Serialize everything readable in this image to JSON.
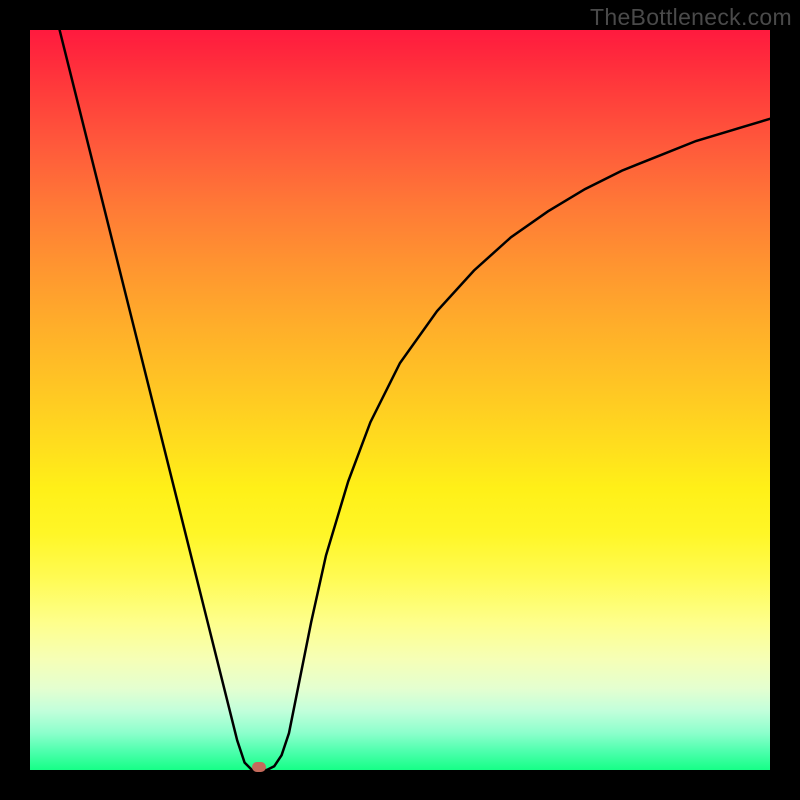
{
  "watermark": "TheBottleneck.com",
  "marker": {
    "color": "#c46a5b"
  },
  "chart_data": {
    "type": "line",
    "title": "",
    "xlabel": "",
    "ylabel": "",
    "xlim": [
      0,
      100
    ],
    "ylim": [
      0,
      100
    ],
    "grid": false,
    "x": [
      4,
      6,
      8,
      10,
      12,
      14,
      16,
      18,
      20,
      22,
      24,
      26,
      28,
      29,
      30,
      31,
      32,
      33,
      34,
      35,
      36,
      38,
      40,
      43,
      46,
      50,
      55,
      60,
      65,
      70,
      75,
      80,
      85,
      90,
      95,
      100
    ],
    "values": [
      100,
      92,
      84,
      76,
      68,
      60,
      52,
      44,
      36,
      28,
      20,
      12,
      4,
      1,
      0,
      0,
      0,
      0.5,
      2,
      5,
      10,
      20,
      29,
      39,
      47,
      55,
      62,
      67.5,
      72,
      75.5,
      78.5,
      81,
      83,
      85,
      86.5,
      88
    ],
    "optimum_x": 31,
    "legend": false
  }
}
